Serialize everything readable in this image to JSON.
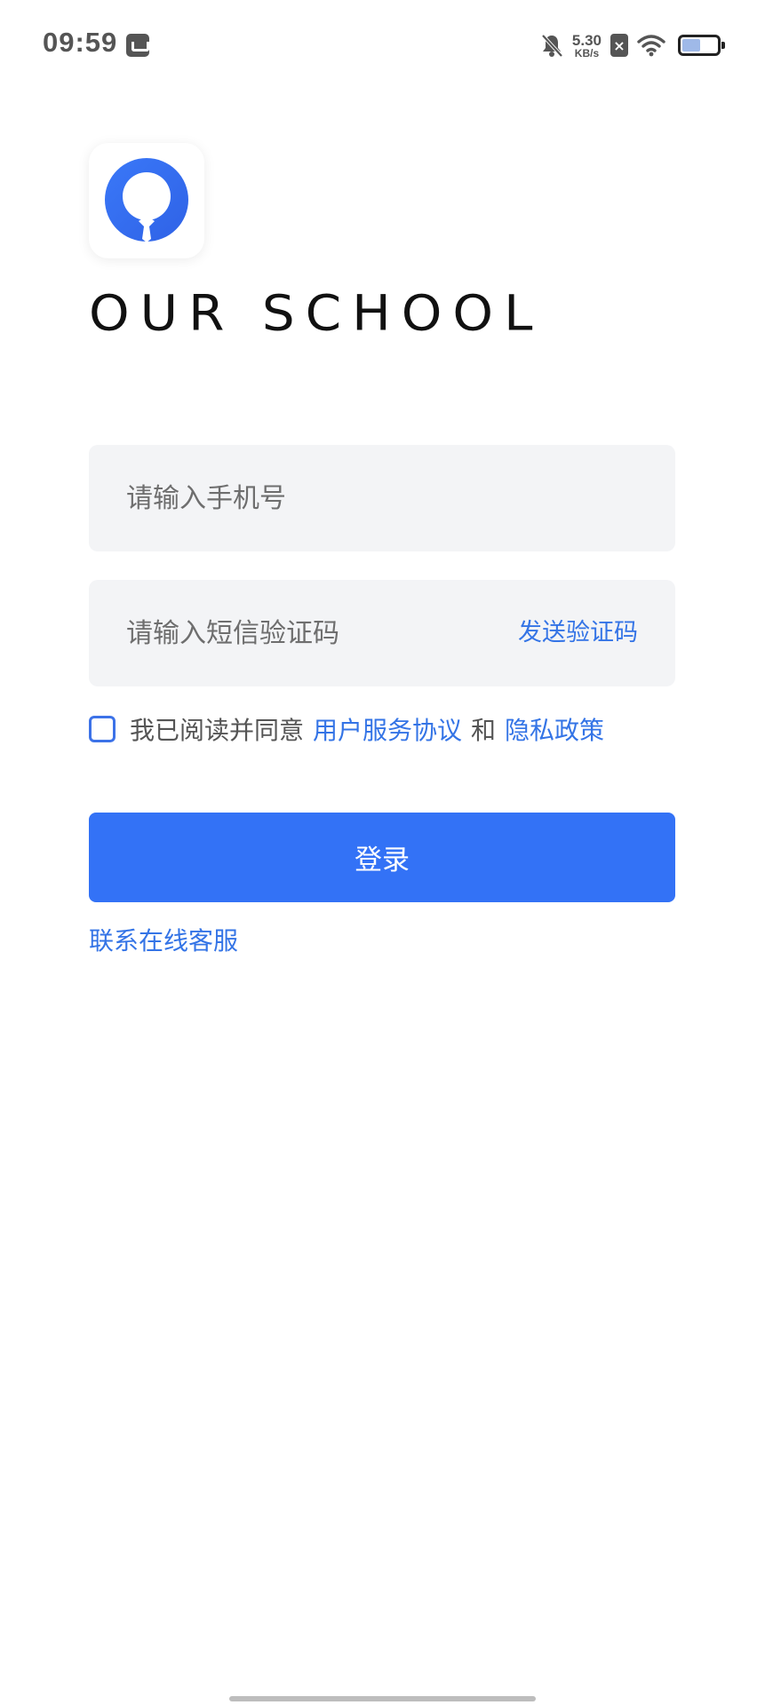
{
  "status_bar": {
    "time": "09:59",
    "speed_value": "5.30",
    "speed_unit": "KB/s",
    "icons": [
      "app-notification-icon",
      "bell-muted-icon",
      "sim-x-icon",
      "wifi-icon",
      "battery-icon"
    ]
  },
  "brand": {
    "name": "OUR SCHOOL",
    "logo_color": "#3372f6"
  },
  "login_form": {
    "phone_placeholder": "请输入手机号",
    "code_placeholder": "请输入短信验证码",
    "send_code_label": "发送验证码",
    "agreement": {
      "prefix": "我已阅读并同意",
      "terms_link": "用户服务协议",
      "and": "和",
      "privacy_link": "隐私政策",
      "checked": false
    },
    "login_label": "登录",
    "support_label": "联系在线客服"
  },
  "colors": {
    "accent": "#3372f6",
    "link": "#3474e6",
    "field_bg": "#f3f4f6"
  }
}
